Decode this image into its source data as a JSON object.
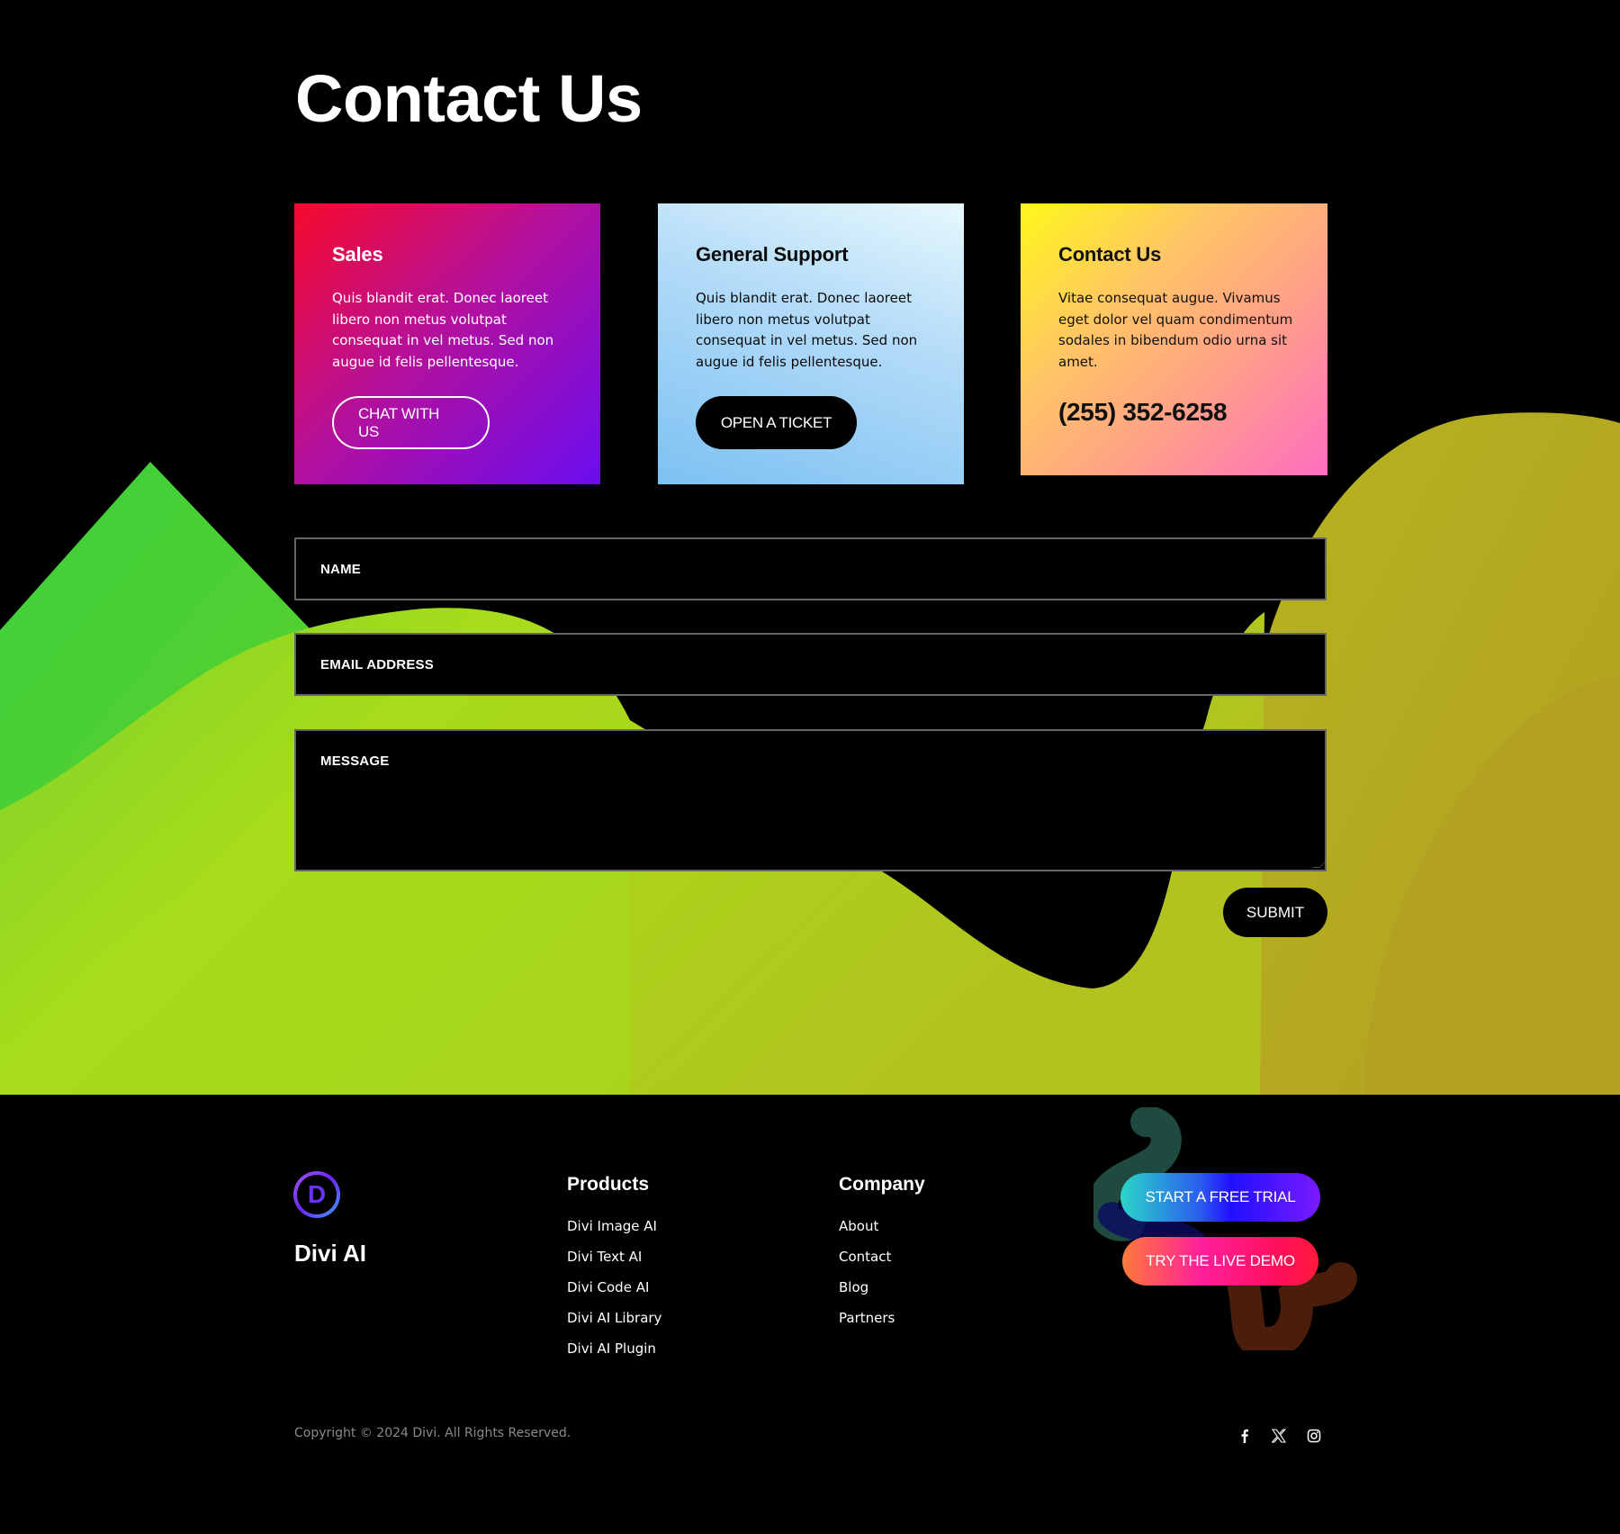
{
  "page": {
    "title": "Contact Us"
  },
  "cards": [
    {
      "title": "Sales",
      "body": "Quis blandit erat. Donec laoreet libero non metus volutpat consequat in vel metus. Sed non augue id felis pellentesque.",
      "button": "CHAT WITH US"
    },
    {
      "title": "General Support",
      "body": "Quis blandit erat. Donec laoreet libero non metus volutpat consequat in vel metus. Sed non augue id felis pellentesque.",
      "button": "OPEN A TICKET"
    },
    {
      "title": "Contact Us",
      "body": "Vitae consequat augue. Vivamus eget dolor vel quam condimentum sodales in bibendum odio urna sit amet.",
      "phone": "(255) 352-6258"
    }
  ],
  "form": {
    "name_label": "NAME",
    "email_label": "EMAIL ADDRESS",
    "message_label": "MESSAGE",
    "submit": "SUBMIT"
  },
  "footer": {
    "brand": "Divi AI",
    "logo_letter": "D",
    "products": {
      "title": "Products",
      "items": [
        "Divi Image AI",
        "Divi Text AI",
        "Divi Code AI",
        "Divi AI Library",
        "Divi AI Plugin"
      ]
    },
    "company": {
      "title": "Company",
      "items": [
        "About",
        "Contact",
        "Blog",
        "Partners"
      ]
    },
    "cta_trial": "START A FREE TRIAL",
    "cta_demo": "TRY THE LIVE DEMO",
    "copyright": "Copyright © 2024 Divi. All Rights Reserved.",
    "social": [
      "facebook-icon",
      "x-twitter-icon",
      "instagram-icon"
    ]
  },
  "colors": {
    "background": "#000000",
    "green": "#3ccf3c",
    "lime": "#a8dc1a",
    "olive": "#b3b020"
  }
}
